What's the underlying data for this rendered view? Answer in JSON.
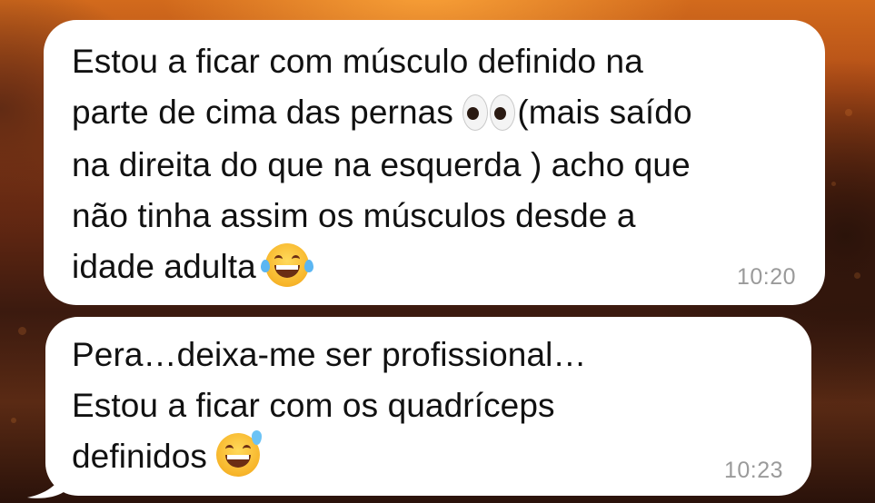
{
  "chat": {
    "messages": [
      {
        "lines": [
          "Estou a ficar com músculo definido na",
          "parte de cima das pernas",
          "(mais saído",
          "na direita do que na esquerda ) acho que",
          "não tinha assim os músculos desde a",
          "idade adulta"
        ],
        "emojis": [
          "eyes-emoji",
          "tears-of-joy-emoji"
        ],
        "time": "10:20"
      },
      {
        "lines": [
          "Pera…deixa-me ser profissional…",
          "Estou a ficar com os quadríceps",
          "definidos"
        ],
        "emojis": [
          "grinning-sweat-emoji"
        ],
        "time": "10:23"
      }
    ]
  },
  "colors": {
    "bubble": "#ffffff",
    "text": "#111111",
    "timestamp": "#9a9a9a",
    "wallpaper": "#6b2a12"
  }
}
